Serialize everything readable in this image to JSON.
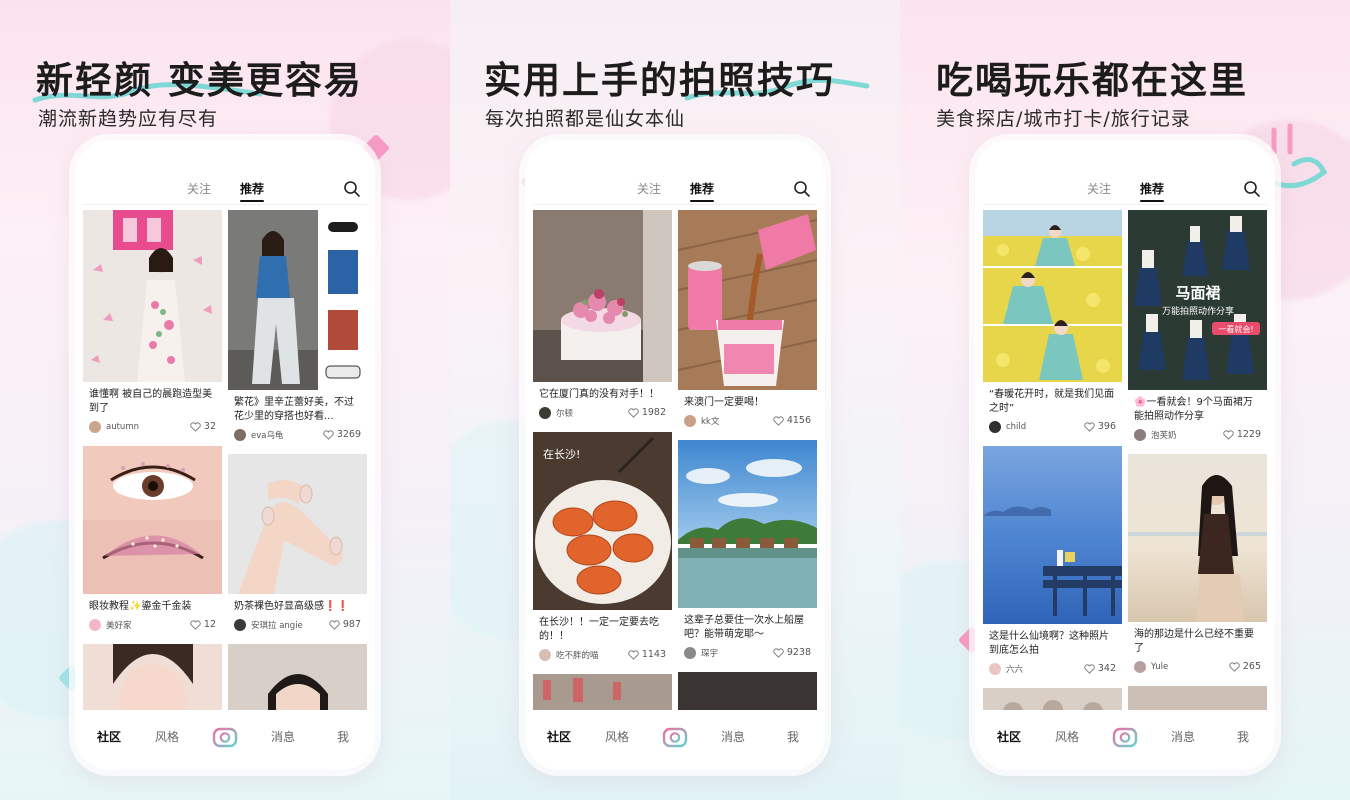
{
  "panels": [
    {
      "headline": "新轻颜 变美更容易",
      "subline": "潮流新趋势应有尽有",
      "tabs": {
        "follow": "关注",
        "recommend": "推荐"
      },
      "left": [
        {
          "title": "谁懂啊 被自己的晨跑造型美到了",
          "author": "autumn",
          "likes": "32"
        },
        {
          "title": "眼妆教程✨鎏金千金装",
          "author": "美好家",
          "likes": "12"
        }
      ],
      "right": [
        {
          "title": "繁花》里辛芷蕾好美，不过花少里的穿搭也好看...",
          "author": "eva乌龟",
          "likes": "3269"
        },
        {
          "title": "奶茶裸色好显高级感❗❗",
          "author": "安琪拉 angie",
          "likes": "987"
        }
      ]
    },
    {
      "headline": "实用上手的拍照技巧",
      "subline": "每次拍照都是仙女本仙",
      "tabs": {
        "follow": "关注",
        "recommend": "推荐"
      },
      "left": [
        {
          "title": "它在厦门真的没有对手！！",
          "author": "尔顿",
          "likes": "1982"
        },
        {
          "title": "在长沙！！一定一定要去吃的！！",
          "author": "吃不胖的喵",
          "likes": "1143"
        }
      ],
      "right": [
        {
          "title": "来澳门一定要喝！",
          "author": "kk文",
          "likes": "4156"
        },
        {
          "title": "这辈子总要住一次水上船屋吧？能带萌宠耶～",
          "author": "琛宇",
          "likes": "9238"
        }
      ]
    },
    {
      "headline": "吃喝玩乐都在这里",
      "subline": "美食探店/城市打卡/旅行记录",
      "tabs": {
        "follow": "关注",
        "recommend": "推荐"
      },
      "left": [
        {
          "title": "“春暖花开时，就是我们见面之时”",
          "author": "child",
          "likes": "396"
        },
        {
          "title": "这是什么仙境啊？这种照片到底怎么拍",
          "author": "六六",
          "likes": "342"
        }
      ],
      "right": [
        {
          "title": "🌸一看就会！9个马面裙万能拍照动作分享",
          "author": "泡芙奶",
          "likes": "1229"
        },
        {
          "title": "海的那边是什么已经不重要了",
          "author": "Yule",
          "likes": "265"
        }
      ]
    }
  ],
  "image_overlays": {
    "p2_crab": "在长沙!",
    "p3_skirt_big": "马面裙",
    "p3_skirt_small": "万能拍照动作分享",
    "p3_skirt_badge": "一看就会!"
  },
  "nav": {
    "community": "社区",
    "style": "风格",
    "messages": "消息",
    "me": "我"
  },
  "colors": {
    "accent_pink": "#f06fa6",
    "accent_teal": "#5fd3d0"
  },
  "icons": [
    "search-icon",
    "heart-icon",
    "camera-icon"
  ]
}
